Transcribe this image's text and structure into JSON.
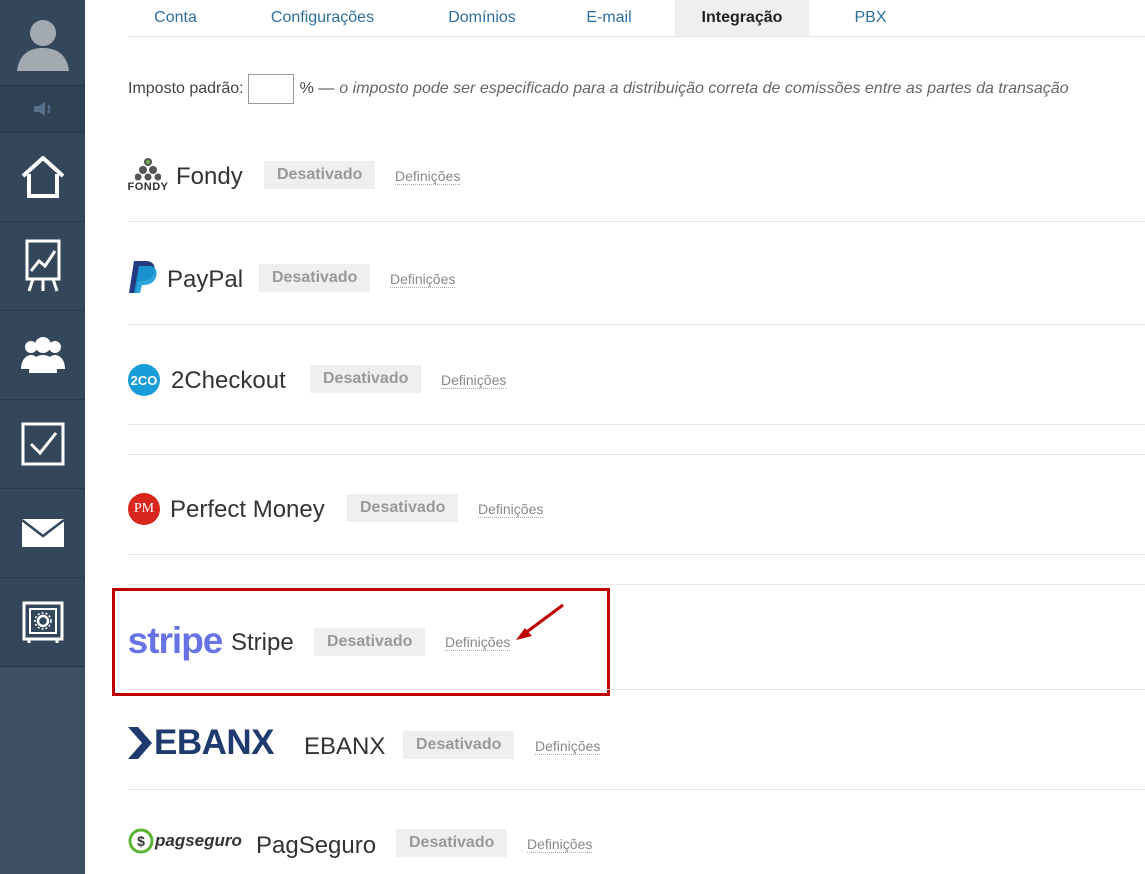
{
  "tabs": [
    {
      "label": "Conta"
    },
    {
      "label": "Configurações"
    },
    {
      "label": "Domínios"
    },
    {
      "label": "E-mail"
    },
    {
      "label": "Integração"
    },
    {
      "label": "PBX"
    }
  ],
  "active_tab": "Integração",
  "tax": {
    "label": "Imposto padrão:",
    "value": "",
    "note_prefix": "% —",
    "note": "o imposto pode ser especificado para a distribuição correta de comissões entre as partes da transação"
  },
  "integrations": [
    {
      "name": "Fondy",
      "logo_text": "FONDY",
      "status": "Desativado",
      "settings_label": "Definições"
    },
    {
      "name": "PayPal",
      "logo_text": "",
      "status": "Desativado",
      "settings_label": "Definições"
    },
    {
      "name": "2Checkout",
      "logo_text": "2CO",
      "status": "Desativado",
      "settings_label": "Definições"
    },
    {
      "name": "Perfect Money",
      "logo_text": "PM",
      "status": "Desativado",
      "settings_label": "Definições"
    },
    {
      "name": "Stripe",
      "logo_text": "stripe",
      "status": "Desativado",
      "settings_label": "Definições"
    },
    {
      "name": "EBANX",
      "logo_text": "EBANX",
      "status": "Desativado",
      "settings_label": "Definições"
    },
    {
      "name": "PagSeguro",
      "logo_text": "pagseguro",
      "status": "Desativado",
      "settings_label": "Definições"
    }
  ],
  "sidebar": {
    "items": [
      {
        "icon": "home-icon"
      },
      {
        "icon": "chart-board-icon"
      },
      {
        "icon": "users-icon"
      },
      {
        "icon": "checkbox-icon"
      },
      {
        "icon": "mail-icon"
      },
      {
        "icon": "safe-icon"
      }
    ]
  },
  "colors": {
    "sidebar": "#394a5c",
    "tab_link": "#2f6f9e",
    "highlight": "#c00000",
    "stripe": "#6772e5",
    "ebanx": "#1e3a6e",
    "paypal_dark": "#253b80",
    "paypal_light": "#179bd7",
    "twoco": "#1a9cd8",
    "perfect_money": "#d9261c",
    "pagseguro": "#5bb334"
  }
}
